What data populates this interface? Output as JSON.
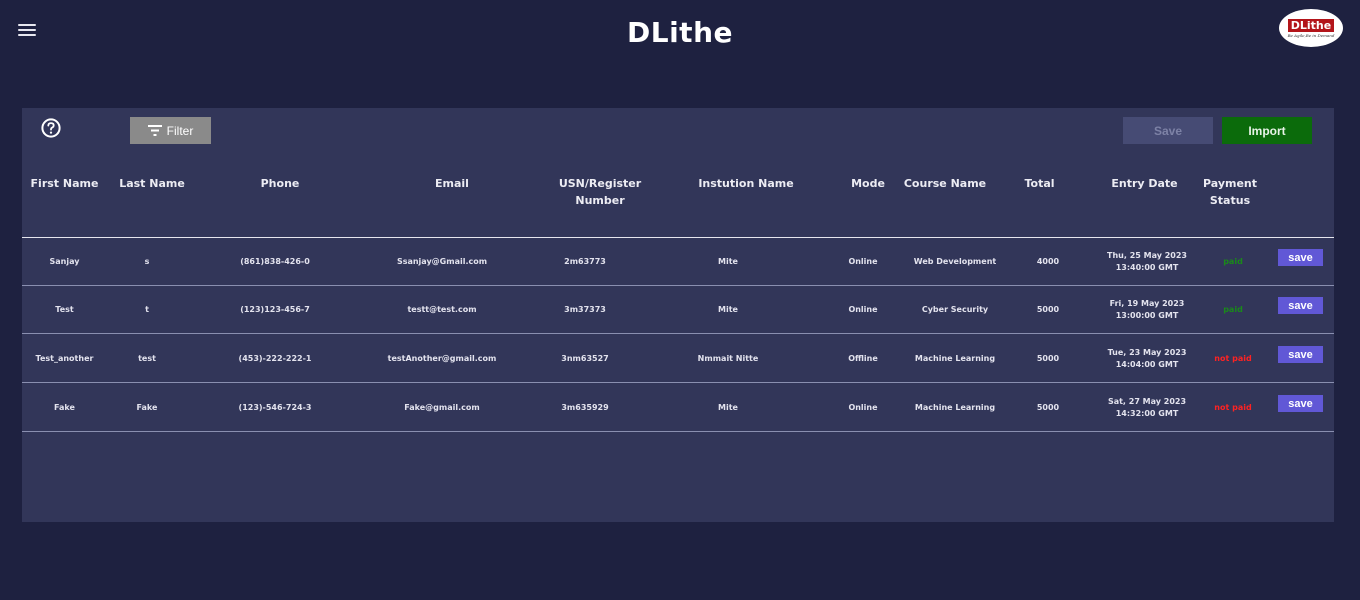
{
  "header": {
    "title": "DLithe",
    "logo_text": "DLithe",
    "logo_tagline": "Be Agile,Be in Demand"
  },
  "toolbar": {
    "filter_label": "Filter",
    "save_label": "Save",
    "import_label": "Import"
  },
  "columns": {
    "first_name": "First Name",
    "last_name": "Last Name",
    "phone": "Phone",
    "email": "Email",
    "usn_line1": "USN/Register",
    "usn_line2": "Number",
    "institution": "Instution Name",
    "mode": "Mode",
    "course": "Course Name",
    "total": "Total",
    "entry_date": "Entry Date",
    "payment_line1": "Payment",
    "payment_line2": "Status"
  },
  "rows": [
    {
      "first": "Sanjay",
      "last": "s",
      "phone": "(861)838-426-0",
      "email": "Ssanjay@Gmail.com",
      "usn": "2m63773",
      "institution": "Mite",
      "mode": "Online",
      "course": "Web Development",
      "total": "4000",
      "date1": "Thu, 25 May 2023",
      "date2": "13:40:00 GMT",
      "status": "paid",
      "save": "save"
    },
    {
      "first": "Test",
      "last": "t",
      "phone": "(123)123-456-7",
      "email": "testt@test.com",
      "usn": "3m37373",
      "institution": "Mite",
      "mode": "Online",
      "course": "Cyber Security",
      "total": "5000",
      "date1": "Fri, 19 May 2023",
      "date2": "13:00:00 GMT",
      "status": "paid",
      "save": "save"
    },
    {
      "first": "Test_another",
      "last": "test",
      "phone": "(453)-222-222-1",
      "email": "testAnother@gmail.com",
      "usn": "3nm63527",
      "institution": "Nmmait Nitte",
      "mode": "Offline",
      "course": "Machine Learning",
      "total": "5000",
      "date1": "Tue, 23 May 2023",
      "date2": "14:04:00 GMT",
      "status": "not paid",
      "save": "save"
    },
    {
      "first": "Fake",
      "last": "Fake",
      "phone": "(123)-546-724-3",
      "email": "Fake@gmail.com",
      "usn": "3m635929",
      "institution": "Mite",
      "mode": "Online",
      "course": "Machine Learning",
      "total": "5000",
      "date1": "Sat, 27 May 2023",
      "date2": "14:32:00 GMT",
      "status": "not paid",
      "save": "save"
    }
  ],
  "colors": {
    "background": "#1e2140",
    "panel": "#323659",
    "import": "#0b6b0b",
    "row_save": "#6158d6",
    "paid": "#1a8a1a",
    "not_paid": "#ff2222"
  }
}
